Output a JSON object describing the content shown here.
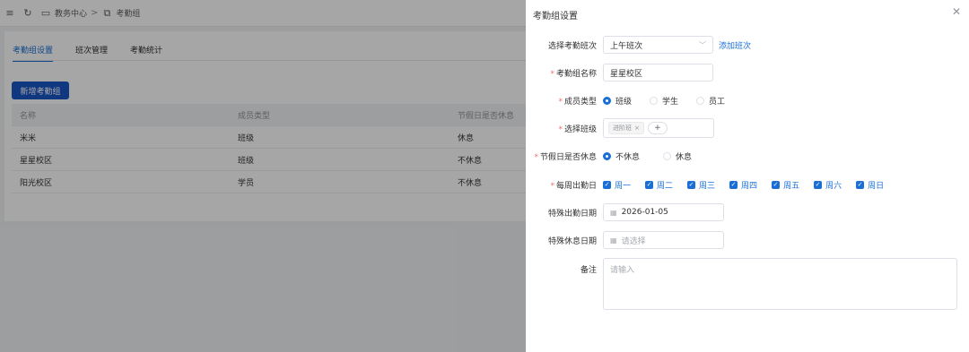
{
  "topbar": {
    "menu_icon": "menu-icon",
    "refresh_icon": "refresh-icon",
    "crumb1": "教务中心",
    "crumb_sep": ">",
    "crumb2": "考勤组"
  },
  "tabs": [
    {
      "label": "考勤组设置",
      "active": true
    },
    {
      "label": "班次管理",
      "active": false
    },
    {
      "label": "考勤统计",
      "active": false
    }
  ],
  "new_button": "新增考勤组",
  "table": {
    "headers": [
      "名称",
      "成员类型",
      "节假日是否休息"
    ],
    "rows": [
      [
        "米米",
        "班级",
        "休息"
      ],
      [
        "星星校区",
        "班级",
        "不休息"
      ],
      [
        "阳光校区",
        "学员",
        "不休息"
      ]
    ]
  },
  "drawer": {
    "title": "考勤组设置",
    "close_icon": "close-icon",
    "shift": {
      "label": "选择考勤班次",
      "value": "上午班次",
      "add_link": "添加班次"
    },
    "name": {
      "label": "考勤组名称",
      "value": "星星校区"
    },
    "member_type": {
      "label": "成员类型",
      "options": [
        "班级",
        "学生",
        "员工"
      ],
      "selected": "班级"
    },
    "class_select": {
      "label": "选择班级",
      "tag": "进阶班",
      "tag_close": "×",
      "add": "+"
    },
    "holiday": {
      "label": "节假日是否休息",
      "options": [
        "不休息",
        "休息"
      ],
      "selected": "不休息"
    },
    "weekdays": {
      "label": "每周出勤日",
      "days": [
        "周一",
        "周二",
        "周三",
        "周四",
        "周五",
        "周六",
        "周日"
      ]
    },
    "special_work": {
      "label": "特殊出勤日期",
      "value": "2026-01-05"
    },
    "special_rest": {
      "label": "特殊休息日期",
      "placeholder": "请选择"
    },
    "remark": {
      "label": "备注",
      "placeholder": "请输入"
    }
  },
  "colors": {
    "primary": "#1a6fd6",
    "button": "#1a56c7",
    "required": "#f56c6c"
  }
}
